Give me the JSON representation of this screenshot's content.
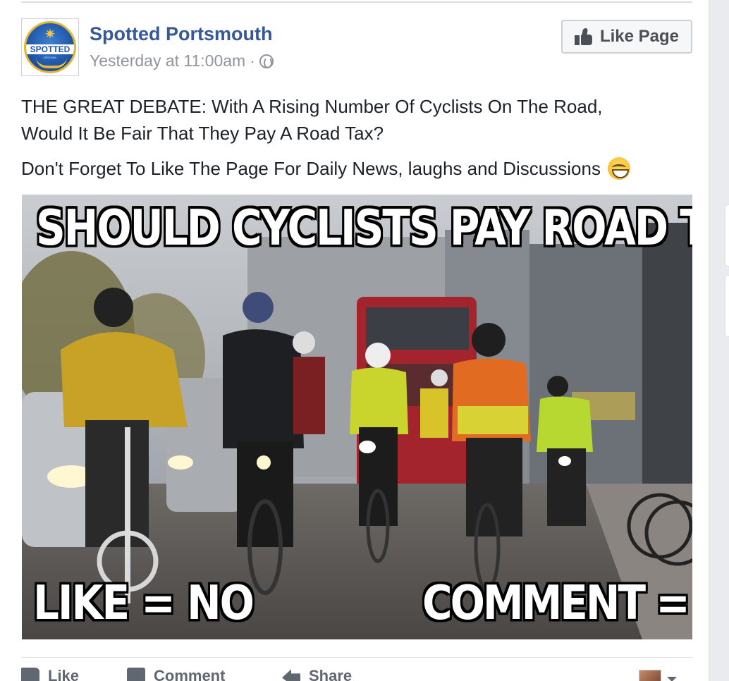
{
  "post": {
    "page_name": "Spotted Portsmouth",
    "timestamp": "Yesterday at 11:00am",
    "separator": "·",
    "audience_icon": "globe-icon",
    "avatar_logo_text": "SPOTTED",
    "avatar_logo_subtext": "ORIGINAL",
    "like_page_label": "Like Page",
    "text_line_1": "THE GREAT DEBATE: With A Rising Number Of Cyclists On The Road,",
    "text_line_2": "Would It Be Fair That They Pay A Road Tax?",
    "text_line_3": "Don't Forget To Like The Page For Daily News, laughs and Discussions",
    "emoji": "grinning-face"
  },
  "image": {
    "caption_top": "SHOULD CYCLISTS PAY ROAD TAX?",
    "caption_left": "LIKE = NO",
    "caption_right": "COMMENT = YES"
  },
  "actions": {
    "like_label": "Like",
    "comment_label": "Comment",
    "share_label": "Share"
  },
  "colors": {
    "page_name": "#365899",
    "meta": "#90949c",
    "text": "#1d2129",
    "action_text": "#616770"
  }
}
